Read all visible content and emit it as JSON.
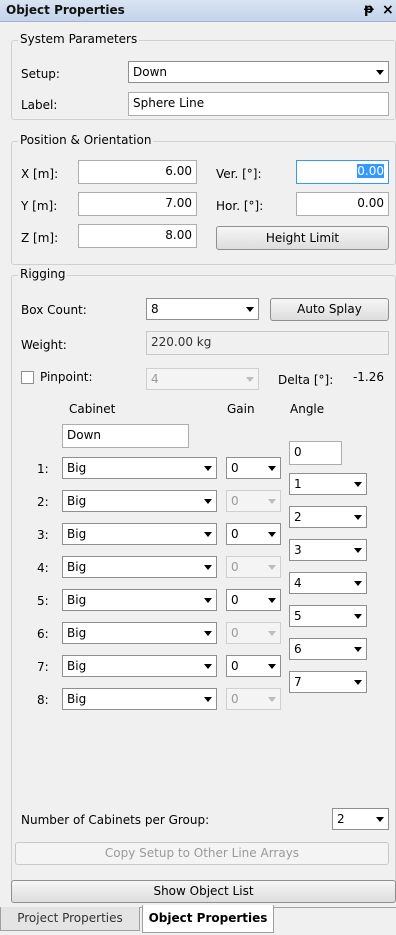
{
  "panel": {
    "title": "Object Properties",
    "pin_icon": "pin-icon",
    "close_icon": "close-icon"
  },
  "system": {
    "group_label": "System Parameters",
    "setup_label": "Setup:",
    "setup_value": "Down",
    "label_label": "Label:",
    "label_value": "Sphere Line"
  },
  "position": {
    "group_label": "Position & Orientation",
    "x_label": "X [m]:",
    "x_value": "6.00",
    "y_label": "Y [m]:",
    "y_value": "7.00",
    "z_label": "Z [m]:",
    "z_value": "8.00",
    "ver_label": "Ver. [°]:",
    "ver_value": "0.00",
    "hor_label": "Hor. [°]:",
    "hor_value": "0.00",
    "height_limit_label": "Height Limit"
  },
  "rigging": {
    "group_label": "Rigging",
    "box_count_label": "Box Count:",
    "box_count_value": "8",
    "auto_splay_label": "Auto Splay",
    "weight_label": "Weight:",
    "weight_value": "220.00 kg",
    "pinpoint_label": "Pinpoint:",
    "pinpoint_checked": false,
    "pinpoint_value": "4",
    "delta_label": "Delta [°]:",
    "delta_value": "-1.26",
    "col_cabinet": "Cabinet",
    "col_gain": "Gain",
    "col_angle": "Angle",
    "cabinet_top": "Down",
    "angle_top": "0",
    "rows": [
      {
        "index": "1:",
        "cabinet": "Big",
        "gain": "0",
        "gain_enabled": true,
        "angle": "1"
      },
      {
        "index": "2:",
        "cabinet": "Big",
        "gain": "0",
        "gain_enabled": false,
        "angle": "2"
      },
      {
        "index": "3:",
        "cabinet": "Big",
        "gain": "0",
        "gain_enabled": true,
        "angle": "3"
      },
      {
        "index": "4:",
        "cabinet": "Big",
        "gain": "0",
        "gain_enabled": false,
        "angle": "4"
      },
      {
        "index": "5:",
        "cabinet": "Big",
        "gain": "0",
        "gain_enabled": true,
        "angle": "5"
      },
      {
        "index": "6:",
        "cabinet": "Big",
        "gain": "0",
        "gain_enabled": false,
        "angle": "6"
      },
      {
        "index": "7:",
        "cabinet": "Big",
        "gain": "0",
        "gain_enabled": true,
        "angle": "7"
      },
      {
        "index": "8:",
        "cabinet": "Big",
        "gain": "0",
        "gain_enabled": false,
        "angle": ""
      }
    ],
    "cabinets_per_group_label": "Number of Cabinets per Group:",
    "cabinets_per_group_value": "2",
    "copy_setup_label": "Copy Setup to Other Line Arrays"
  },
  "show_object_list_label": "Show Object List",
  "tabs": [
    {
      "label": "Project Properties",
      "active": false
    },
    {
      "label": "Object Properties",
      "active": true
    }
  ]
}
